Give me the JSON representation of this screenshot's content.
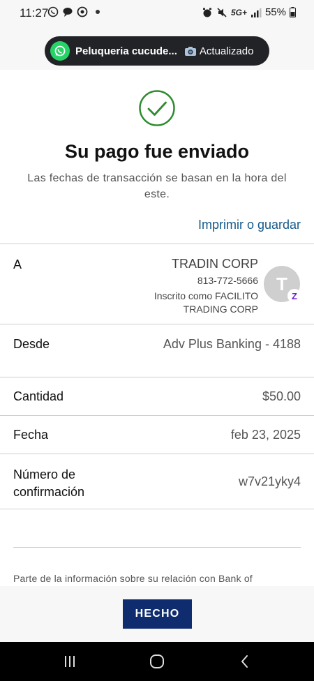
{
  "status_bar": {
    "time": "11:27",
    "battery": "55%",
    "network": "5G+"
  },
  "notification": {
    "app_icon": "whatsapp-icon",
    "title": "Peluqueria cucude...",
    "status": "Actualizado"
  },
  "confirmation": {
    "title": "Su pago fue enviado",
    "subtitle": "Las fechas de transacción se basan en la hora del este.",
    "print_link": "Imprimir o guardar"
  },
  "details": {
    "to_label": "A",
    "recipient_name": "TRADIN CORP",
    "recipient_phone": "813-772-5666",
    "recipient_registered_line1": "Inscrito como FACILITO",
    "recipient_registered_line2": "TRADING CORP",
    "avatar_initial": "T",
    "from_label": "Desde",
    "from_value": "Adv Plus Banking - 4188",
    "amount_label": "Cantidad",
    "amount_value": "$50.00",
    "date_label": "Fecha",
    "date_value": "feb 23, 2025",
    "confirmation_label_line1": "Número de",
    "confirmation_label_line2": "confirmación",
    "confirmation_value": "w7v21yky4"
  },
  "disclaimer": "Parte de la información sobre su relación con Bank of",
  "done_button": "HECHO",
  "colors": {
    "primary": "#0e2c6e",
    "link": "#155a8a",
    "success": "#2e8b2e",
    "zelle": "#6d1ed4"
  }
}
